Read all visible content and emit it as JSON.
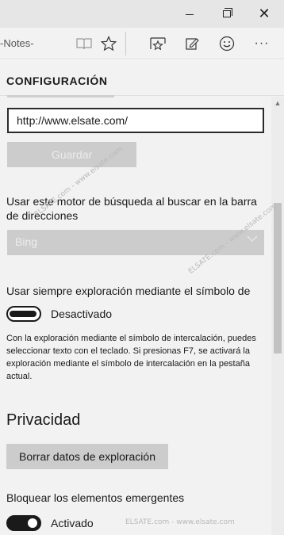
{
  "window": {
    "controls": [
      {
        "name": "minimize-icon"
      },
      {
        "name": "restore-icon"
      },
      {
        "name": "close-icon",
        "glyph": "✕"
      }
    ]
  },
  "toolbar": {
    "tab_label": "-Notes-",
    "icons": [
      "reading-view-icon",
      "favorite-star-icon",
      "hub-favorites-icon",
      "web-note-icon",
      "feedback-smiley-icon",
      "more-ellipsis-icon"
    ],
    "more_glyph": "···"
  },
  "settings": {
    "header": "CONFIGURACIÓN",
    "homepage_url": "http://www.elsate.com/",
    "save_label": "Guardar",
    "search_engine_label": "Usar este motor de búsqueda al buscar en la barra de direcciones",
    "search_engine_value": "Bing",
    "caret_browsing_label": "Usar siempre exploración mediante el símbolo de",
    "caret_browsing_state": "Desactivado",
    "caret_browsing_on": false,
    "caret_browsing_description": "Con la exploración mediante el símbolo de intercalación, puedes seleccionar texto con el teclado. Si presionas F7, se activará la exploración mediante el símbolo de intercalación en la pestaña actual.",
    "privacy_heading": "Privacidad",
    "clear_data_label": "Borrar datos de exploración",
    "popup_block_label": "Bloquear los elementos emergentes",
    "popup_block_state": "Activado",
    "popup_block_on": true
  },
  "watermarks": [
    "ELSATE.com - www.elsate.com",
    "ELSATE.com - www.elsate.com",
    "ELSATE.com - www.elsate.com"
  ],
  "colors": {
    "titlebar": "#e6e6e6",
    "panel": "#f2f2f2",
    "button_disabled": "#cccccc",
    "text": "#1a1a1a"
  }
}
